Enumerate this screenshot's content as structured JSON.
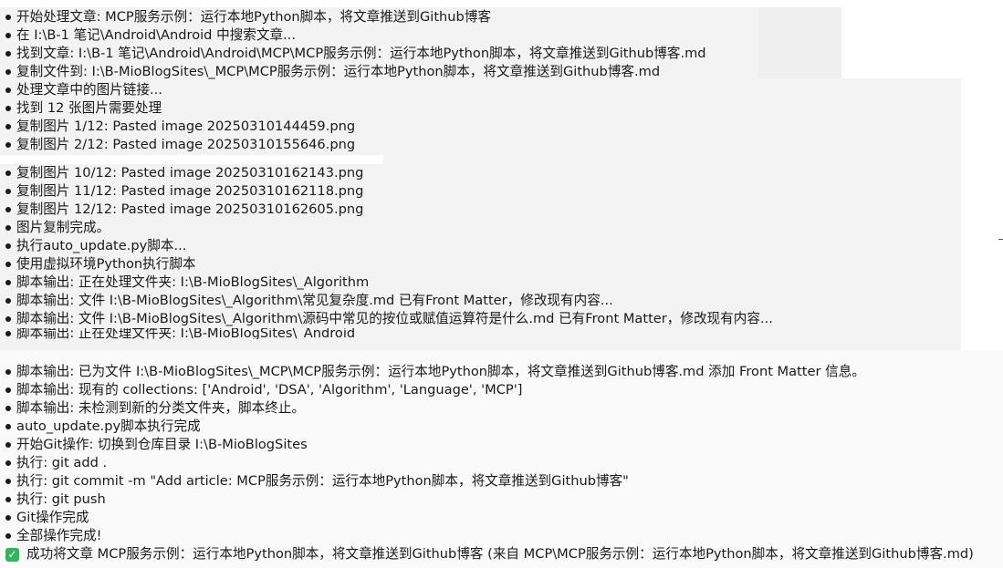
{
  "colors": {
    "background": "#ffffff",
    "panel": "#f3f3f3",
    "text": "#1a1a1a",
    "success": "#31b45a"
  },
  "icons": {
    "bullet": "bullet-icon",
    "success": "check-mark-icon"
  },
  "log_top": [
    "开始处理文章: MCP服务示例：运行本地Python脚本，将文章推送到Github博客",
    "在 I:\\B-1 笔记\\Android\\Android 中搜索文章...",
    "找到文章: I:\\B-1 笔记\\Android\\Android\\MCP\\MCP服务示例：运行本地Python脚本，将文章推送到Github博客.md",
    "复制文件到: I:\\B-MioBlogSites\\_MCP\\MCP服务示例：运行本地Python脚本，将文章推送到Github博客.md",
    "处理文章中的图片链接...",
    "找到 12 张图片需要处理",
    "复制图片 1/12: Pasted image 20250310144459.png",
    "复制图片 2/12: Pasted image 20250310155646.png"
  ],
  "log_middle": [
    "复制图片 10/12: Pasted image 20250310162143.png",
    "复制图片 11/12: Pasted image 20250310162118.png",
    "复制图片 12/12: Pasted image 20250310162605.png",
    "图片复制完成。",
    "执行auto_update.py脚本...",
    "使用虚拟环境Python执行脚本",
    "脚本输出: 正在处理文件夹: I:\\B-MioBlogSites\\_Algorithm",
    "脚本输出: 文件 I:\\B-MioBlogSites\\_Algorithm\\常见复杂度.md 已有Front Matter，修改现有内容...",
    "脚本输出: 文件 I:\\B-MioBlogSites\\_Algorithm\\源码中常见的按位或赋值运算符是什么.md 已有Front Matter，修改现有内容...",
    "脚本输出: 正在处理文件夹: I:\\B-MioBlogSites\\_Android"
  ],
  "log_bottom": [
    "脚本输出: 已为文件 I:\\B-MioBlogSites\\_MCP\\MCP服务示例：运行本地Python脚本，将文章推送到Github博客.md 添加 Front Matter 信息。",
    "脚本输出: 现有的 collections: ['Android', 'DSA', 'Algorithm', 'Language', 'MCP']",
    "脚本输出: 未检测到新的分类文件夹，脚本终止。",
    "auto_update.py脚本执行完成",
    "开始Git操作: 切换到仓库目录 I:\\B-MioBlogSites",
    "执行: git add .",
    "执行: git commit -m \"Add article: MCP服务示例：运行本地Python脚本，将文章推送到Github博客\"",
    "执行: git push",
    "Git操作完成",
    "全部操作完成!"
  ],
  "success_message": "成功将文章 MCP服务示例：运行本地Python脚本，将文章推送到Github博客 (来自 MCP\\MCP服务示例：运行本地Python脚本，将文章推送到Github博客.md)"
}
